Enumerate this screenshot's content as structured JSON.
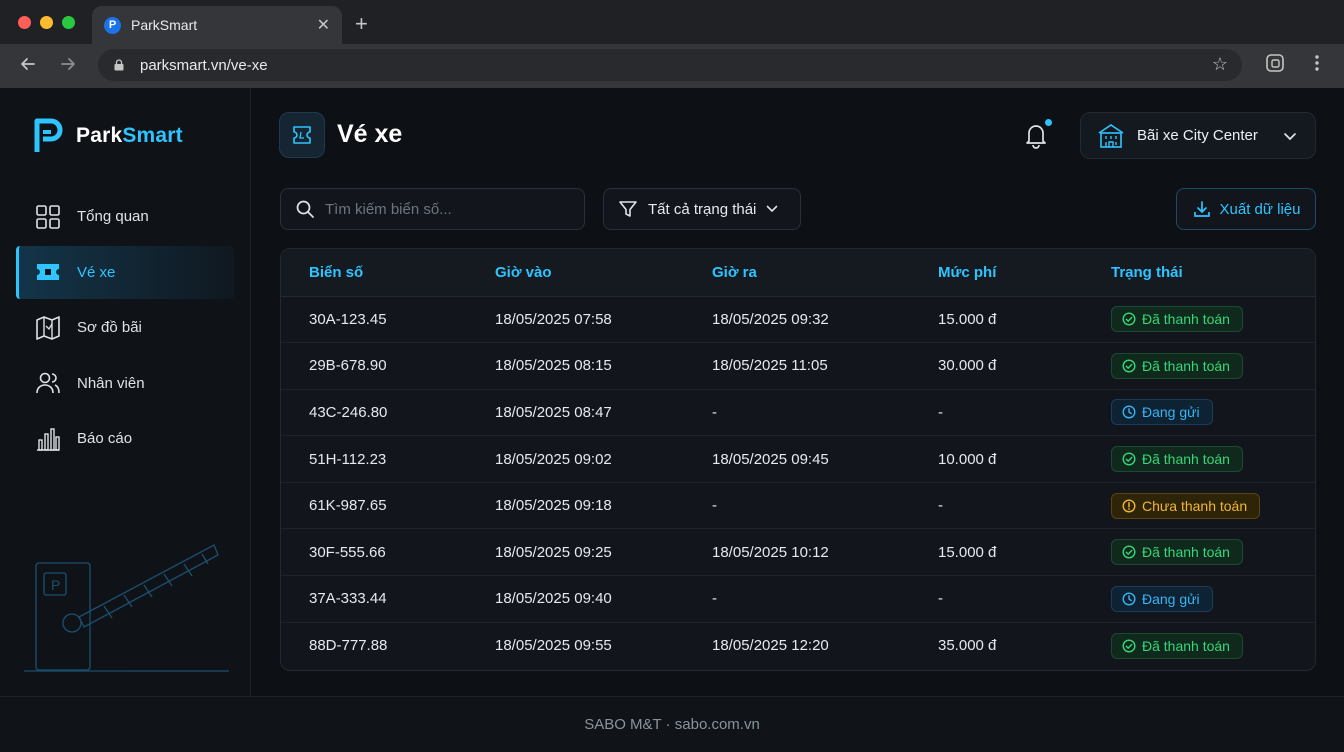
{
  "browser": {
    "tab_title": "ParkSmart",
    "tab_favicon": "P",
    "url": "parksmart.vn/ve-xe"
  },
  "sidebar": {
    "brand_part1": "Park",
    "brand_part2": "Smart",
    "items": [
      {
        "label": "Tổng quan",
        "icon": "dashboard-icon"
      },
      {
        "label": "Vé xe",
        "icon": "ticket-icon",
        "active": true
      },
      {
        "label": "Sơ đồ bãi",
        "icon": "map-icon"
      },
      {
        "label": "Nhân viên",
        "icon": "users-icon"
      },
      {
        "label": "Báo cáo",
        "icon": "chart-icon"
      }
    ]
  },
  "header": {
    "title": "Vé xe",
    "lot_name": "Bãi xe City Center"
  },
  "toolbar": {
    "search_placeholder": "Tìm kiếm biển số...",
    "filter_label": "Tất cả trạng thái",
    "export_label": "Xuất dữ liệu"
  },
  "table": {
    "headers": [
      "Biển số",
      "Giờ vào",
      "Giờ ra",
      "Mức phí",
      "Trạng thái"
    ],
    "rows": [
      [
        "30A-123.45",
        "18/05/2025 07:58",
        "18/05/2025 09:32",
        "15.000 đ",
        "Đã thanh toán"
      ],
      [
        "29B-678.90",
        "18/05/2025 08:15",
        "18/05/2025 11:05",
        "30.000 đ",
        "Đã thanh toán"
      ],
      [
        "43C-246.80",
        "18/05/2025 08:47",
        "-",
        "-",
        "Đang gửi"
      ],
      [
        "51H-112.23",
        "18/05/2025 09:02",
        "18/05/2025 09:45",
        "10.000 đ",
        "Đã thanh toán"
      ],
      [
        "61K-987.65",
        "18/05/2025 09:18",
        "-",
        "-",
        "Chưa thanh toán"
      ],
      [
        "30F-555.66",
        "18/05/2025 09:25",
        "18/05/2025 10:12",
        "15.000 đ",
        "Đã thanh toán"
      ],
      [
        "37A-333.44",
        "18/05/2025 09:40",
        "-",
        "-",
        "Đang gửi"
      ],
      [
        "88D-777.88",
        "18/05/2025 09:55",
        "18/05/2025 12:20",
        "35.000 đ",
        "Đã thanh toán"
      ]
    ],
    "status_kinds": [
      "paid",
      "paid",
      "parked",
      "paid",
      "unpaid",
      "paid",
      "parked",
      "paid"
    ]
  },
  "footer": {
    "text": "SABO M&T · sabo.com.vn"
  },
  "colors": {
    "accent": "#2ec4ff",
    "paid": "#37d67a",
    "parked": "#3ab4f2",
    "unpaid": "#f2b632"
  }
}
